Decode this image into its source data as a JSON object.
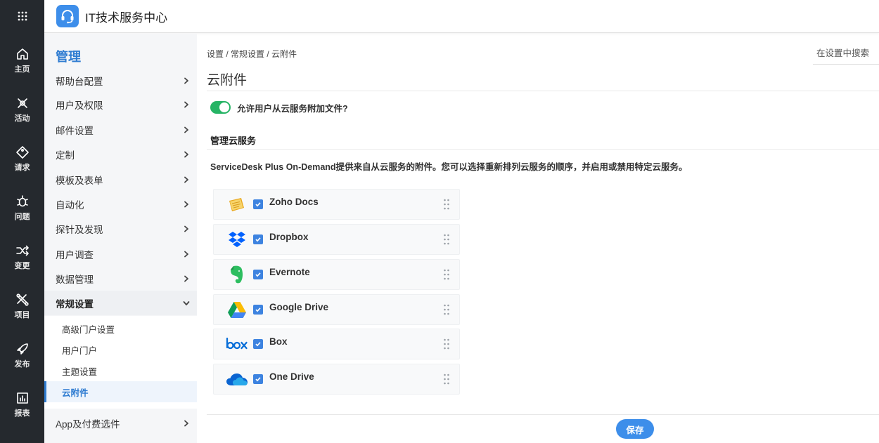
{
  "header": {
    "title": "IT技术服务中心"
  },
  "rail": {
    "items": [
      {
        "label": "主页",
        "icon": "home-icon"
      },
      {
        "label": "活动",
        "icon": "activity-icon"
      },
      {
        "label": "请求",
        "icon": "request-icon"
      },
      {
        "label": "问题",
        "icon": "problem-icon"
      },
      {
        "label": "变更",
        "icon": "change-icon"
      },
      {
        "label": "项目",
        "icon": "project-icon"
      },
      {
        "label": "发布",
        "icon": "release-icon"
      },
      {
        "label": "报表",
        "icon": "report-icon"
      }
    ]
  },
  "menu": {
    "title": "管理",
    "items": [
      "帮助台配置",
      "用户及权限",
      "邮件设置",
      "定制",
      "模板及表单",
      "自动化",
      "探针及发现",
      "用户调查",
      "数据管理",
      "常规设置"
    ],
    "subitems": [
      "高级门户设置",
      "用户门户",
      "主题设置",
      "云附件"
    ],
    "last_item": "App及付费选件"
  },
  "breadcrumb": "设置 / 常规设置 / 云附件",
  "search": {
    "placeholder": "在设置中搜索"
  },
  "page_title": "云附件",
  "toggle": {
    "label": "允许用户从云服务附加文件?",
    "on": true,
    "color": "#26b465"
  },
  "section_title": "管理云服务",
  "description": "ServiceDesk Plus On-Demand提供来自从云服务的附件。您可以选择重新排列云服务的顺序，并启用或禁用特定云服务。",
  "services": [
    {
      "name": "Zoho Docs",
      "icon": "zoho-docs-icon",
      "checked": true
    },
    {
      "name": "Dropbox",
      "icon": "dropbox-icon",
      "checked": true
    },
    {
      "name": "Evernote",
      "icon": "evernote-icon",
      "checked": true
    },
    {
      "name": "Google Drive",
      "icon": "google-drive-icon",
      "checked": true
    },
    {
      "name": "Box",
      "icon": "box-icon",
      "checked": true
    },
    {
      "name": "One Drive",
      "icon": "onedrive-icon",
      "checked": true
    }
  ],
  "save_label": "保存",
  "colors": {
    "accent": "#3d8eea",
    "rail_bg": "#25292e",
    "menu_title": "#2f7cd1"
  }
}
